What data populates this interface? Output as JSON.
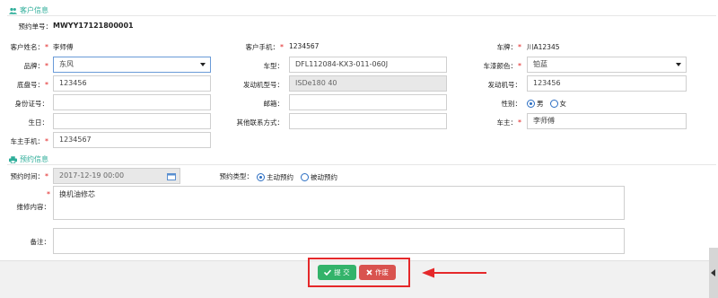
{
  "customer_section": {
    "title": "客户信息",
    "order_no_label": "预约单号：",
    "order_no": "MWYY17121800001",
    "name_label": "客户姓名：",
    "name_value": "李师傅",
    "phone_label": "客户手机：",
    "phone_value": "1234567",
    "plate_label": "车牌：",
    "plate_value": "川A12345",
    "brand_label": "品牌：",
    "brand_value": "东风",
    "model_label": "车型：",
    "model_value": "DFL112084-KX3-011-060J",
    "color_label": "车漆颜色：",
    "color_value": "铂蓝",
    "chassis_label": "底盘号：",
    "chassis_value": "123456",
    "engine_model_label": "发动机型号：",
    "engine_model_value": "ISDe180 40",
    "engine_no_label": "发动机号：",
    "engine_no_value": "123456",
    "id_label": "身份证号：",
    "id_value": "",
    "email_label": "邮箱：",
    "email_value": "",
    "gender_label": "性别：",
    "gender_male": "男",
    "gender_female": "女",
    "birthday_label": "生日：",
    "birthday_value": "",
    "other_contact_label": "其他联系方式：",
    "other_contact_value": "",
    "owner_label": "车主：",
    "owner_value": "李师傅",
    "owner_phone_label": "车主手机：",
    "owner_phone_value": "1234567"
  },
  "booking_section": {
    "title": "预约信息",
    "time_label": "预约时间：",
    "time_value": "2017-12-19 00:00",
    "type_label": "预约类型：",
    "type_active": "主动预约",
    "type_passive": "被动预约",
    "repair_label": "维修内容：",
    "repair_value": "换机油修芯",
    "remark_label": "备注：",
    "remark_value": ""
  },
  "actions": {
    "submit": "提 交",
    "cancel": "作废"
  },
  "colors": {
    "accent": "#2fae9a",
    "submit": "#33b36a",
    "cancel": "#d9534f",
    "annotation": "#e5282a"
  }
}
